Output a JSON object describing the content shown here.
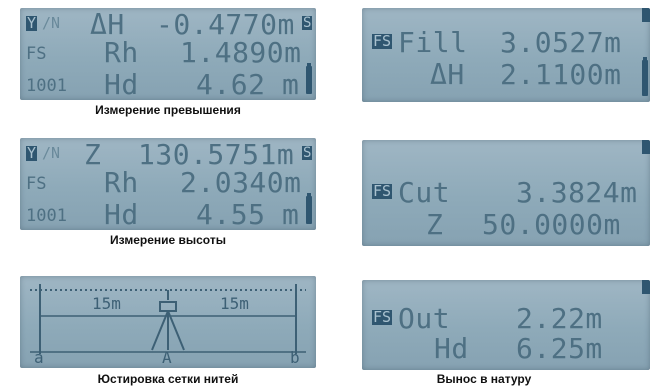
{
  "panels": {
    "height_diff": {
      "r1": {
        "mode_y": "Y",
        "mode_rest": "/N",
        "label": "ΔH",
        "value": "-0.4770m",
        "flag": "S"
      },
      "r2": {
        "tag": "FS",
        "label": "Rh",
        "value": "1.4890m"
      },
      "r3": {
        "tag": "1001",
        "label": "Hd",
        "value": "4.62",
        "unit": "m"
      },
      "caption": "Измерение превышения"
    },
    "elevation": {
      "r1": {
        "mode_y": "Y",
        "mode_rest": "/N",
        "label": "Z",
        "value": "130.5751m",
        "flag": "S"
      },
      "r2": {
        "tag": "FS",
        "label": "Rh",
        "value": "2.0340m"
      },
      "r3": {
        "tag": "1001",
        "label": "Hd",
        "value": "4.55",
        "unit": "m"
      },
      "caption": "Измерение высоты"
    },
    "reticle": {
      "left_dist": "15m",
      "right_dist": "15m",
      "point_a": "a",
      "point_center": "A",
      "point_b": "b",
      "caption": "Юстировка сетки нитей"
    },
    "fill": {
      "r1": {
        "tag": "FS",
        "label": "Fill",
        "value": "3.0527m"
      },
      "r2": {
        "label": "ΔH",
        "value": "2.1100m"
      }
    },
    "cut": {
      "r1": {
        "tag": "FS",
        "label": "Cut",
        "value": "3.3824m"
      },
      "r2": {
        "label": "Z",
        "value": "50.0000m"
      }
    },
    "out": {
      "r1": {
        "tag": "FS",
        "label": "Out",
        "value": "2.22m"
      },
      "r2": {
        "label": "Hd",
        "value": "6.25m"
      },
      "caption": "Вынос в натуру"
    }
  },
  "colors": {
    "lcd": "#94afbf",
    "segment": "#4e7083",
    "inverse": "#2f5670"
  }
}
